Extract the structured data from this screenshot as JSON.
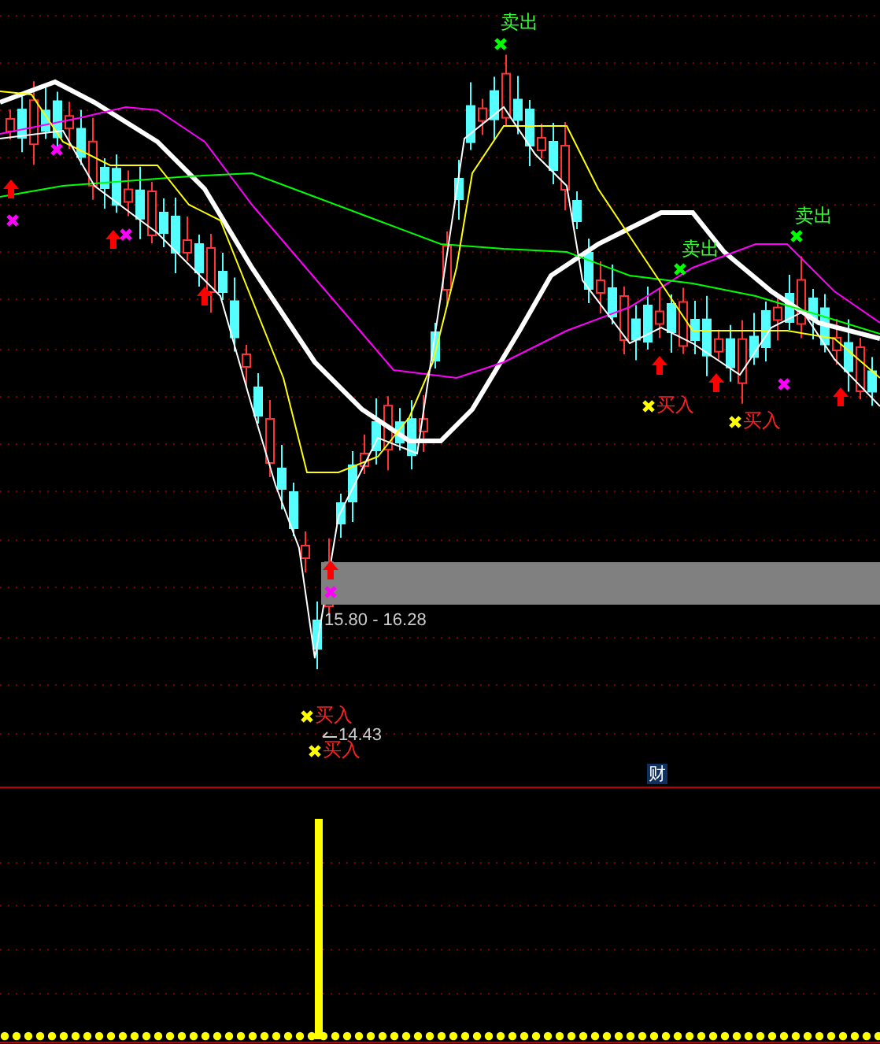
{
  "chart": {
    "sell_signals": [
      {
        "label": "卖出"
      },
      {
        "label": "卖出"
      },
      {
        "label": "卖出"
      }
    ],
    "buy_signals": [
      {
        "label": "买入"
      },
      {
        "label": "买入"
      },
      {
        "label": "买入"
      },
      {
        "label": "买入"
      }
    ],
    "price_band": {
      "label": "15.80 - 16.28"
    },
    "low_price": {
      "label": "14.43"
    },
    "marker": {
      "label": "财"
    }
  }
}
